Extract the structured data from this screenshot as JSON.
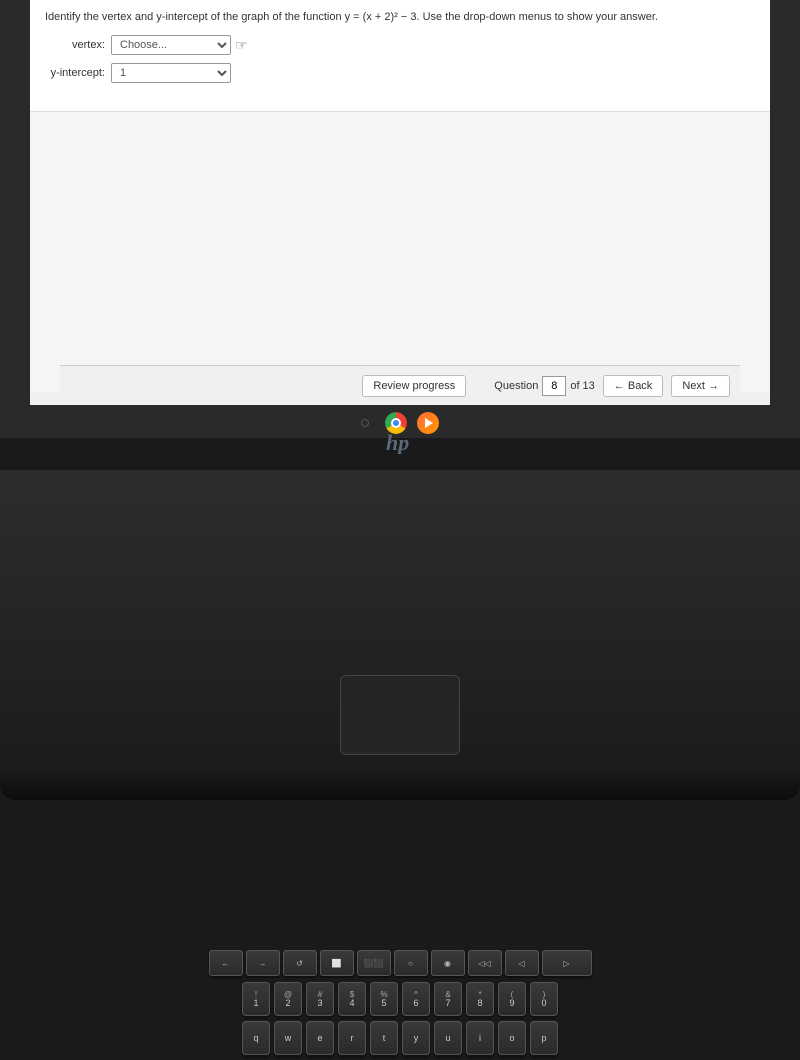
{
  "screen": {
    "question": {
      "text": "Identify the vertex and y-intercept of the graph of the function y = (x + 2)² − 3. Use the drop-down menus to show your answer.",
      "vertex_label": "vertex:",
      "vertex_placeholder": "Choose...",
      "yintercept_label": "y-intercept:",
      "yintercept_value": "1"
    },
    "navbar": {
      "review_label": "Review progress",
      "question_label": "Question",
      "question_current": "8",
      "question_of": "of 13",
      "back_label": "← Back",
      "next_label": "Next →"
    }
  },
  "taskbar": {
    "circle_label": "○"
  },
  "keyboard": {
    "fn_row": [
      "←",
      "→",
      "↺",
      "⬜",
      "⬜⬜",
      "○",
      "○",
      "◁◁",
      "▷▷"
    ],
    "row1_keys": [
      {
        "top": "!",
        "bottom": "1"
      },
      {
        "top": "@",
        "bottom": "2"
      },
      {
        "top": "#",
        "bottom": "3"
      },
      {
        "top": "$",
        "bottom": "4"
      },
      {
        "top": "%",
        "bottom": "5"
      },
      {
        "top": "^",
        "bottom": "6"
      },
      {
        "top": "&",
        "bottom": "7"
      },
      {
        "top": "*",
        "bottom": "8"
      },
      {
        "top": "(",
        "bottom": "9"
      },
      {
        "top": ")",
        "bottom": "0"
      }
    ],
    "row2_keys": [
      "q",
      "w",
      "e",
      "r",
      "t",
      "y",
      "u",
      "i",
      "o",
      "p"
    ],
    "hp_logo": "hp"
  }
}
